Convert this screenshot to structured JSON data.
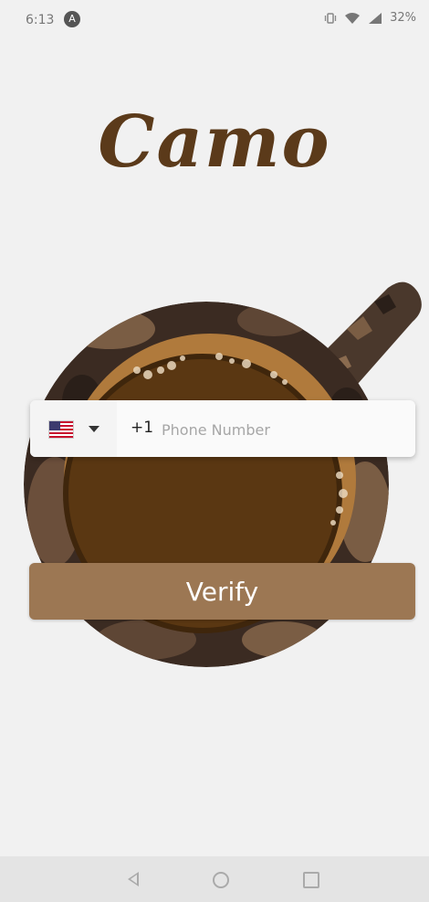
{
  "status_bar": {
    "time": "6:13",
    "app_icon": "A",
    "battery": "32%",
    "icons": [
      "vibrate-icon",
      "wifi-icon",
      "signal-icon",
      "battery-icon"
    ]
  },
  "brand": {
    "name": "Camo"
  },
  "phone_form": {
    "country_flag": "us-flag-icon",
    "dial_code": "+1",
    "placeholder": "Phone Number",
    "value": ""
  },
  "verify_button": {
    "label": "Verify"
  },
  "colors": {
    "brand_brown": "#5b3a1a",
    "button": "#9c7753",
    "coffee": "#5a3712",
    "crema": "#b07a3c",
    "camo_dark": "#3b2b22",
    "camo_light": "#7a5d44",
    "background": "#f1f1f1"
  },
  "nav_bar": {
    "items": [
      "back-icon",
      "home-icon",
      "recents-icon"
    ]
  }
}
